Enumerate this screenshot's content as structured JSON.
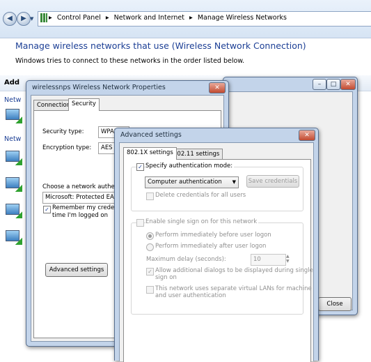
{
  "explorer": {
    "breadcrumbs": [
      "Control Panel",
      "Network and Internet",
      "Manage Wireless Networks"
    ],
    "title": "Manage wireless networks that use (Wireless Network Connection)",
    "subtitle": "Windows tries to connect to these networks in the order listed below.",
    "add_label": "Add",
    "network_labels": [
      "Netw",
      "Netw"
    ]
  },
  "props_dialog": {
    "title": "wirelessnps Wireless Network Properties",
    "tabs": [
      "Connection",
      "Security"
    ],
    "security_type_label": "Security type:",
    "security_type_value": "WPA2",
    "encryption_type_label": "Encryption type:",
    "encryption_type_value": "AES",
    "auth_method_label": "Choose a network authenticat",
    "auth_method_value": "Microsoft: Protected EAP (P",
    "remember_label": "Remember my credentials",
    "remember_label2": "time I'm logged on",
    "advanced_button": "Advanced settings"
  },
  "back_window": {
    "close_button": "Close"
  },
  "advanced_dialog": {
    "title": "Advanced settings",
    "tabs": [
      "802.1X settings",
      "802.11 settings"
    ],
    "specify_auth_label": "Specify authentication mode:",
    "auth_mode_value": "Computer authentication",
    "save_credentials": "Save credentials",
    "delete_credentials": "Delete credentials for all users",
    "sso_label": "Enable single sign on for this network",
    "perform_before": "Perform immediately before user logon",
    "perform_after": "Perform immediately after user logon",
    "max_delay_label": "Maximum delay (seconds):",
    "max_delay_value": "10",
    "allow_dialogs_1": "Allow additional dialogs to be displayed during single",
    "allow_dialogs_2": "sign on",
    "vlan_1": "This network uses separate virtual LANs for machine",
    "vlan_2": "and user authentication"
  }
}
